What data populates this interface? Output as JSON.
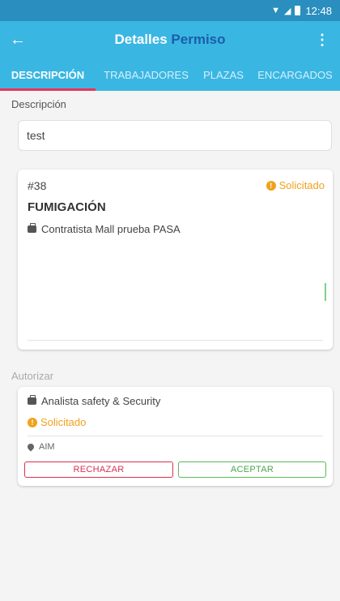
{
  "status_bar": {
    "time": "12:48"
  },
  "app_bar": {
    "title_part1": "Detalles",
    "title_part2": "Permiso"
  },
  "tabs": [
    {
      "label": "DESCRIPCIÓN"
    },
    {
      "label": "TRABAJADORES"
    },
    {
      "label": "PLAZAS"
    },
    {
      "label": "ENCARGADOS"
    }
  ],
  "description": {
    "label": "Descripción",
    "value": "test"
  },
  "permit": {
    "number": "#38",
    "status": "Solicitado",
    "title": "FUMIGACIÓN",
    "contractor": "Contratista Mall prueba PASA"
  },
  "authorize": {
    "label": "Autorizar",
    "role": "Analista safety & Security",
    "status": "Solicitado",
    "location": "AIM",
    "reject_label": "RECHAZAR",
    "accept_label": "ACEPTAR"
  },
  "colors": {
    "primary": "#3ab6e3",
    "accent": "#e8345a",
    "warning": "#f0a21c",
    "reject": "#d7334f",
    "accept": "#5cb85c"
  }
}
